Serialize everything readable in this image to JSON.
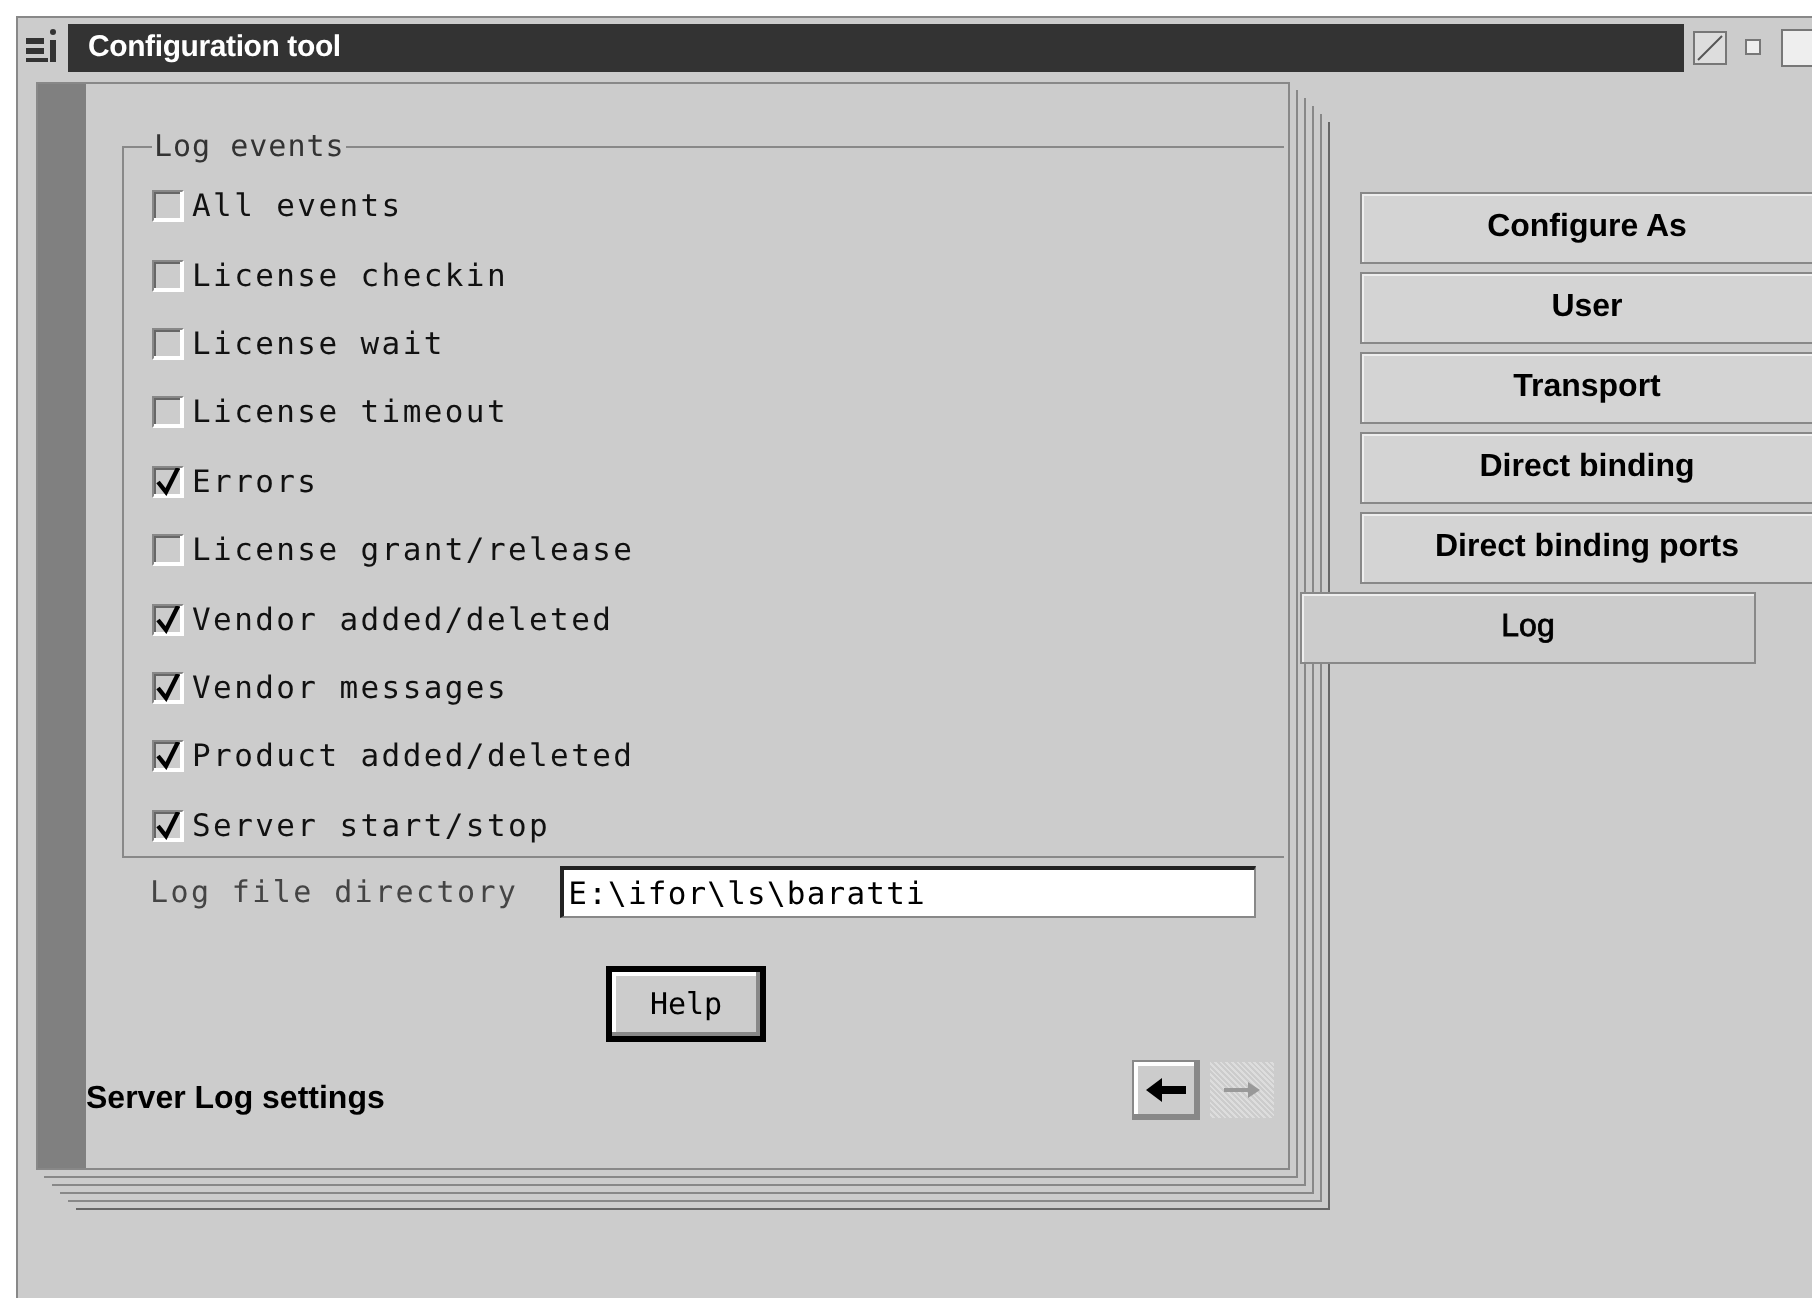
{
  "window": {
    "title": "Configuration tool"
  },
  "group": {
    "title": "Log events",
    "options": [
      {
        "label": "All events",
        "checked": false
      },
      {
        "label": "License checkin",
        "checked": false
      },
      {
        "label": "License wait",
        "checked": false
      },
      {
        "label": "License timeout",
        "checked": false
      },
      {
        "label": "Errors",
        "checked": true
      },
      {
        "label": "License grant/release",
        "checked": false
      },
      {
        "label": "Vendor added/deleted",
        "checked": true
      },
      {
        "label": "Vendor messages",
        "checked": true
      },
      {
        "label": "Product added/deleted",
        "checked": true
      },
      {
        "label": "Server start/stop",
        "checked": true
      }
    ]
  },
  "directory": {
    "label": "Log file directory",
    "value": "E:\\ifor\\ls\\baratti"
  },
  "help_button": "Help",
  "status": "Server Log settings",
  "tabs": [
    {
      "label": "Configure As",
      "selected": false
    },
    {
      "label": "User",
      "selected": false
    },
    {
      "label": "Transport",
      "selected": false
    },
    {
      "label": "Direct binding",
      "selected": false
    },
    {
      "label": "Direct binding ports",
      "selected": false
    },
    {
      "label": "Log",
      "selected": true
    }
  ]
}
